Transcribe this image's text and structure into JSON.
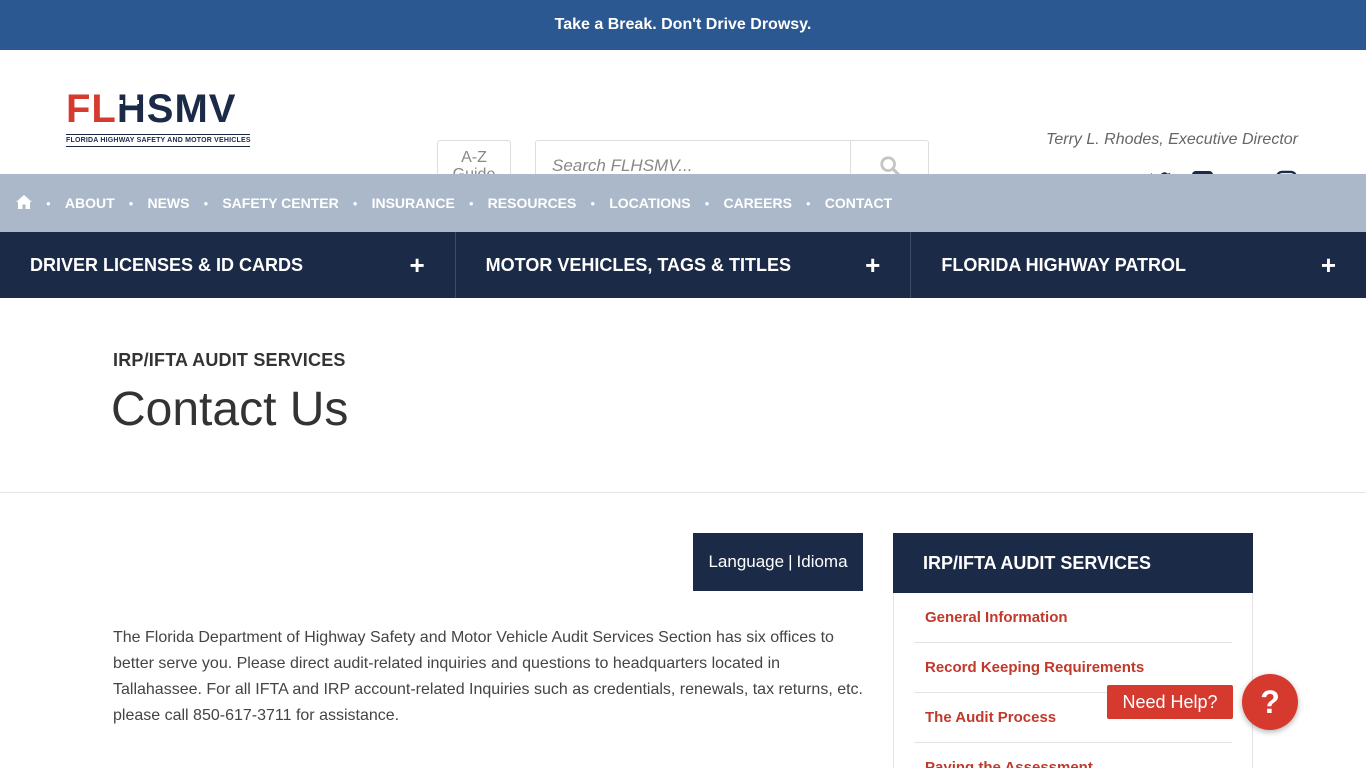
{
  "banner": {
    "text": "Take a Break. Don't Drive Drowsy."
  },
  "logo": {
    "part1": "FL",
    "part2": "H",
    "part3": "SMV",
    "tagline": "FLORIDA HIGHWAY SAFETY AND MOTOR VEHICLES"
  },
  "az_guide": {
    "line1": "A-Z",
    "line2": "Guide"
  },
  "search": {
    "placeholder": "Search FLHSMV..."
  },
  "director": "Terry L. Rhodes, Executive Director",
  "social_icons": [
    "twitter-icon",
    "facebook-icon",
    "youtube-icon",
    "instagram-icon"
  ],
  "nav_secondary": [
    "ABOUT",
    "NEWS",
    "SAFETY CENTER",
    "INSURANCE",
    "RESOURCES",
    "LOCATIONS",
    "CAREERS",
    "CONTACT"
  ],
  "nav_primary": [
    "DRIVER LICENSES & ID CARDS",
    "MOTOR VEHICLES, TAGS & TITLES",
    "FLORIDA HIGHWAY PATROL"
  ],
  "hero": {
    "eyebrow": "IRP/IFTA AUDIT SERVICES",
    "title": "Contact Us"
  },
  "language": {
    "en": "Language",
    "sep": "|",
    "es": "Idioma"
  },
  "body_text": "The Florida Department of Highway Safety and Motor Vehicle Audit Services Section has six offices to better serve you. Please direct audit-related inquiries and questions to headquarters located in Tallahassee. For all IFTA and IRP account-related Inquiries such as credentials, renewals, tax returns, etc. please call 850-617-3711 for assistance.",
  "sidebar": {
    "heading": "IRP/IFTA AUDIT SERVICES",
    "items": [
      "General Information",
      "Record Keeping Requirements",
      "The Audit Process",
      "Paying the Assessment"
    ]
  },
  "help": {
    "label": "Need Help?",
    "glyph": "?"
  },
  "colors": {
    "banner": "#2b5890",
    "navy": "#1b2a47",
    "nav_gray": "#abb8c9",
    "accent_red": "#d63a2f"
  }
}
